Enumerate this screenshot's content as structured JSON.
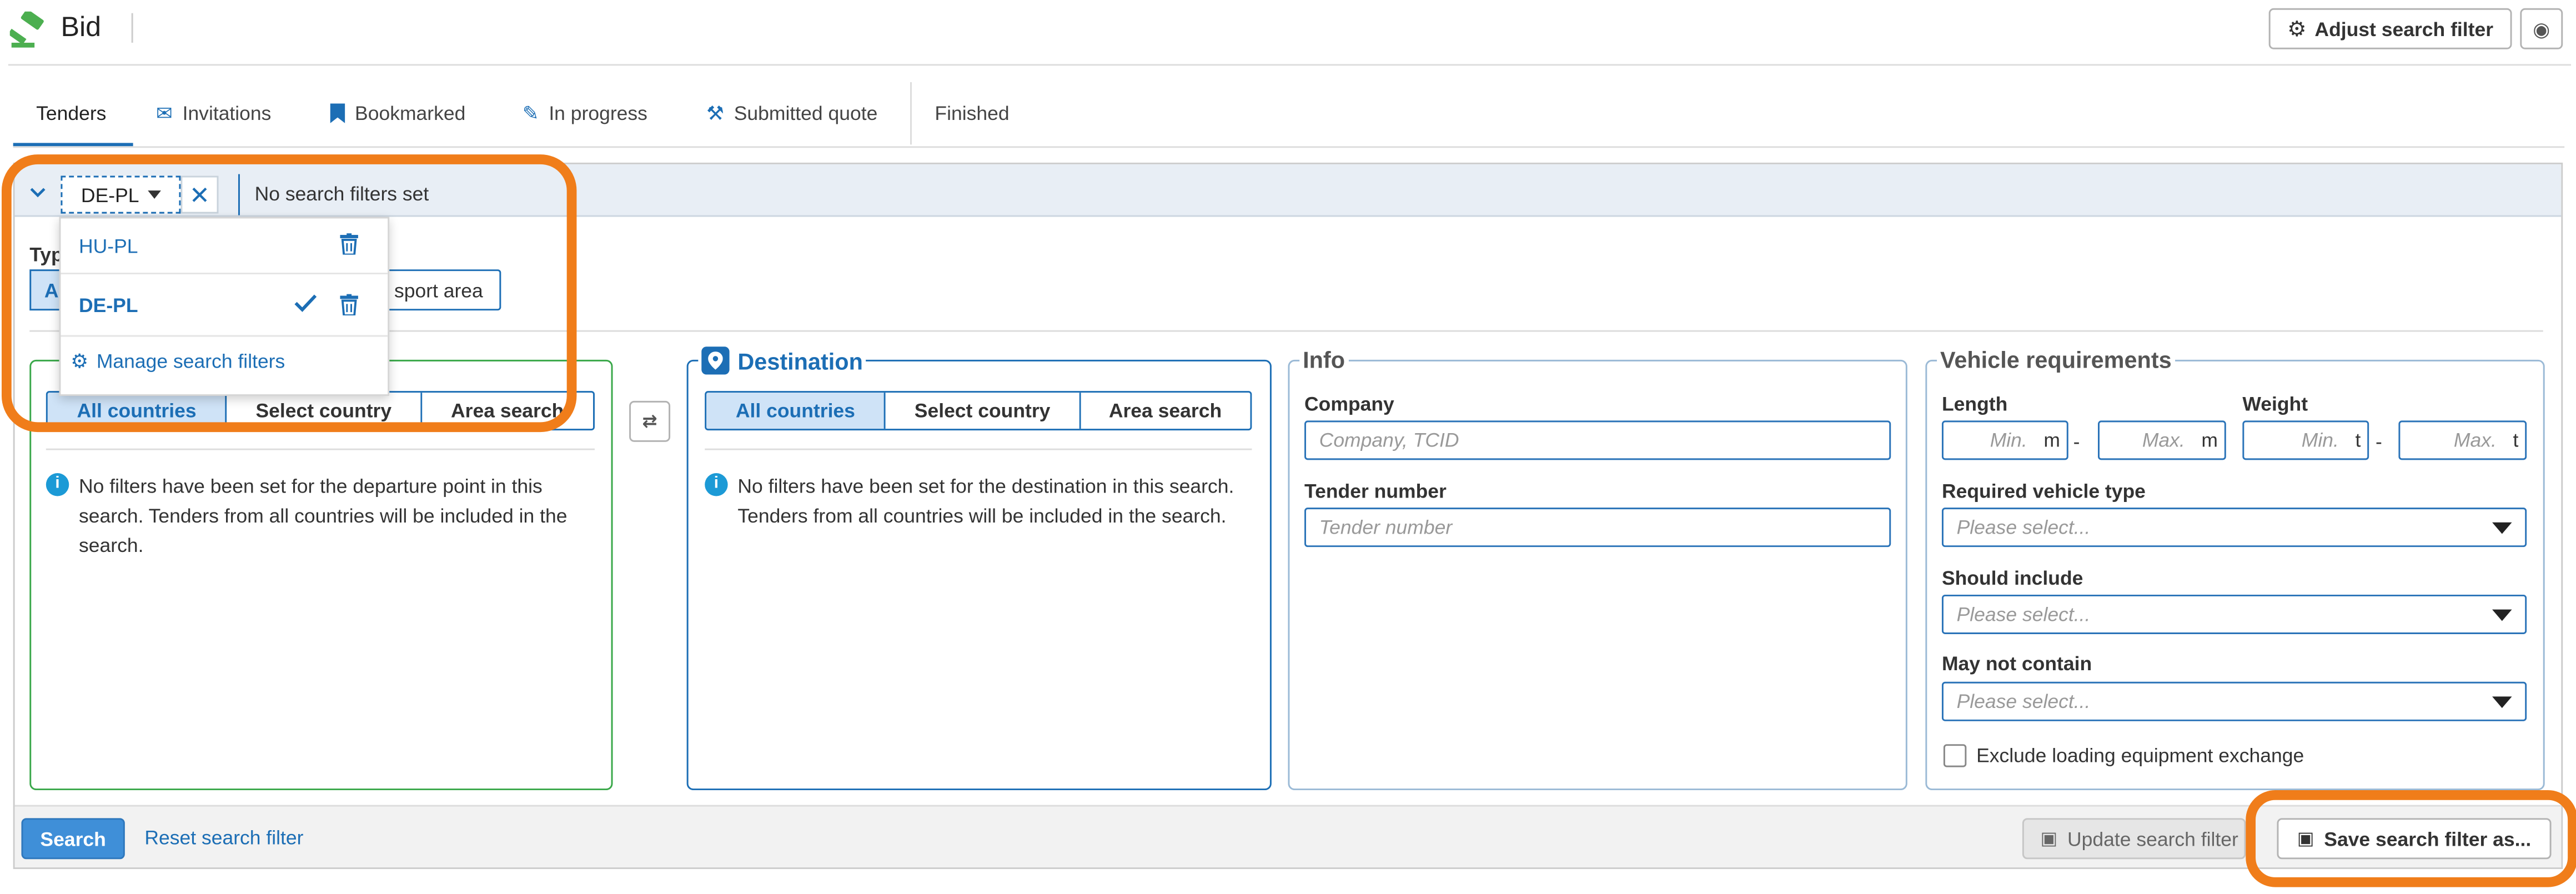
{
  "app": {
    "title": "Bid"
  },
  "header": {
    "adjust_label": "Adjust search filter"
  },
  "tabs": [
    {
      "label": "Tenders",
      "icon": "none"
    },
    {
      "label": "Invitations",
      "icon": "envelope-icon"
    },
    {
      "label": "Bookmarked",
      "icon": "bookmark-icon"
    },
    {
      "label": "In progress",
      "icon": "pencil-icon"
    },
    {
      "label": "Submitted quote",
      "icon": "gavel-icon"
    },
    {
      "label": "Finished",
      "icon": "none"
    }
  ],
  "filter_bar": {
    "current": "DE-PL",
    "status": "No search filters set"
  },
  "dropdown": {
    "items": [
      {
        "label": "HU-PL",
        "selected": false
      },
      {
        "label": "DE-PL",
        "selected": true
      }
    ],
    "manage_label": "Manage search filters"
  },
  "type_row": {
    "label_fragment": "Typ",
    "btn_fragment_left": "A",
    "btn_fragment_right": "sport area"
  },
  "departure": {
    "seg": [
      "All countries",
      "Select country",
      "Area search"
    ],
    "info": "No filters have been set for the departure point in this search. Tenders from all countries will be included in the search."
  },
  "destination": {
    "title": "Destination",
    "seg": [
      "All countries",
      "Select country",
      "Area search"
    ],
    "info": "No filters have been set for the destination in this search. Tenders from all countries will be included in the search."
  },
  "info_panel": {
    "title": "Info",
    "company_label": "Company",
    "company_placeholder": "Company, TCID",
    "tender_label": "Tender number",
    "tender_placeholder": "Tender number"
  },
  "vehicle": {
    "title": "Vehicle requirements",
    "length_label": "Length",
    "weight_label": "Weight",
    "min": "Min.",
    "max": "Max.",
    "unit_m": "m",
    "unit_t": "t",
    "dash": "-",
    "required_label": "Required vehicle type",
    "should_label": "Should include",
    "maynot_label": "May not contain",
    "placeholder": "Please select...",
    "exclude_label": "Exclude loading equipment exchange"
  },
  "footer": {
    "search": "Search",
    "reset": "Reset search filter",
    "update": "Update search filter",
    "save_as": "Save search filter as..."
  },
  "colors": {
    "accent": "#1c6eb5",
    "highlight": "#f07d1a",
    "departure_border": "#3aa84a"
  }
}
